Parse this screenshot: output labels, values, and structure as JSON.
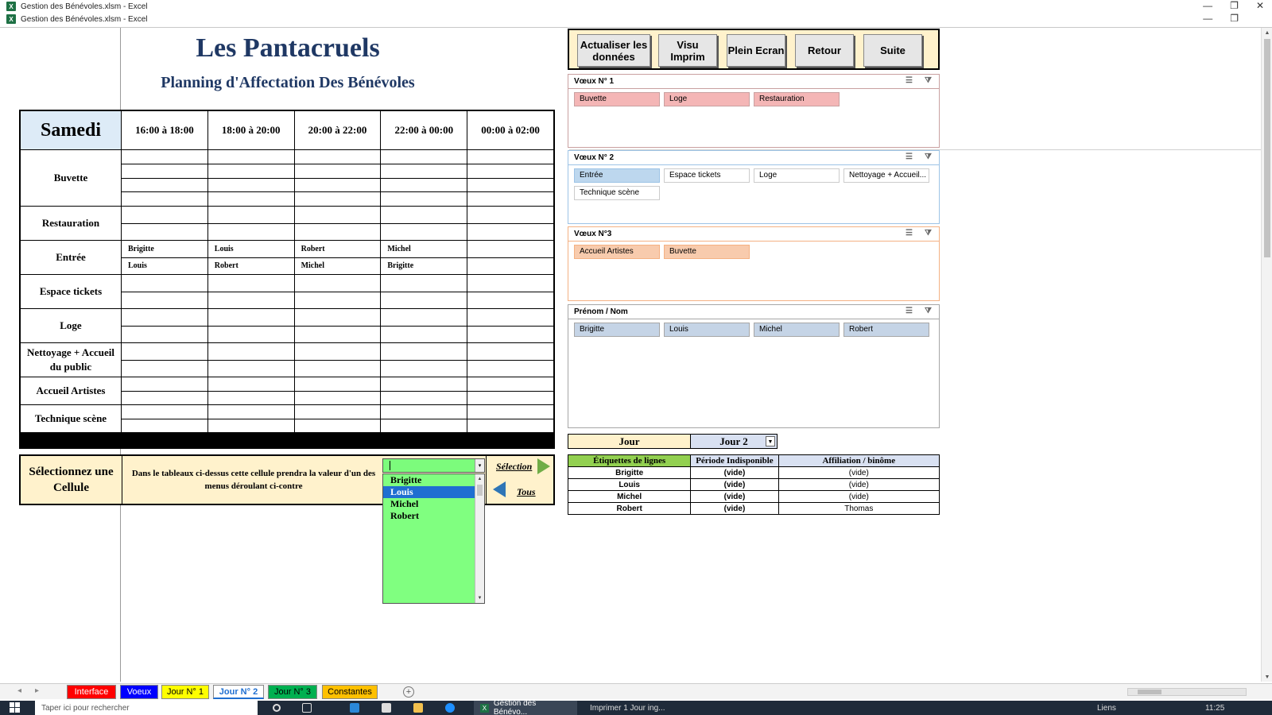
{
  "window": {
    "title1": "Gestion des Bénévoles.xlsm - Excel",
    "title2": "Gestion des Bénévoles.xlsm - Excel",
    "app_badge": "X",
    "controls": [
      "—",
      "❐",
      "✕"
    ]
  },
  "header": {
    "title": "Les Pantacruels",
    "subtitle": "Planning d'Affectation Des Bénévoles"
  },
  "planning": {
    "day": "Samedi",
    "time_slots": [
      "16:00 à 18:00",
      "18:00 à 20:00",
      "20:00 à 22:00",
      "22:00 à 00:00",
      "00:00 à 02:00"
    ],
    "rows": [
      {
        "label": "Buvette",
        "slots": [
          [
            "",
            "",
            "",
            ""
          ],
          [
            "",
            "",
            "",
            ""
          ],
          [
            "",
            "",
            "",
            ""
          ],
          [
            "",
            "",
            "",
            ""
          ],
          [
            "",
            "",
            "",
            ""
          ]
        ]
      },
      {
        "label": "Restauration",
        "slots": [
          [
            "",
            ""
          ],
          [
            "",
            ""
          ],
          [
            "",
            ""
          ],
          [
            "",
            ""
          ],
          [
            "",
            ""
          ]
        ]
      },
      {
        "label": "Entrée",
        "slots": [
          [
            "Brigitte",
            "Louis"
          ],
          [
            "Louis",
            "Robert"
          ],
          [
            "Robert",
            "Michel"
          ],
          [
            "Michel",
            "Brigitte"
          ],
          [
            "",
            ""
          ]
        ]
      },
      {
        "label": "Espace tickets",
        "slots": [
          [
            "",
            ""
          ],
          [
            "",
            ""
          ],
          [
            "",
            ""
          ],
          [
            "",
            ""
          ],
          [
            "",
            ""
          ]
        ]
      },
      {
        "label": "Loge",
        "slots": [
          [
            "",
            ""
          ],
          [
            "",
            ""
          ],
          [
            "",
            ""
          ],
          [
            "",
            ""
          ],
          [
            "",
            ""
          ]
        ]
      },
      {
        "label": "Nettoyage + Accueil du public",
        "slots": [
          [
            "",
            ""
          ],
          [
            "",
            ""
          ],
          [
            "",
            ""
          ],
          [
            "",
            ""
          ],
          [
            "",
            ""
          ]
        ]
      },
      {
        "label": "Accueil Artistes",
        "slots": [
          [
            "",
            ""
          ],
          [
            "",
            ""
          ],
          [
            "",
            ""
          ],
          [
            "",
            ""
          ],
          [
            "",
            ""
          ]
        ]
      },
      {
        "label": "Technique scène",
        "slots": [
          [
            "",
            ""
          ],
          [
            "",
            ""
          ],
          [
            "",
            ""
          ],
          [
            "",
            ""
          ],
          [
            "",
            ""
          ]
        ]
      }
    ]
  },
  "selection": {
    "label": "Sélectionnez une Cellule",
    "hint": "Dans le tableaux ci-dessus cette cellule prendra la valeur d'un des menus déroulant  ci-contre",
    "selection_link": "Sélection",
    "all_link": "Tous"
  },
  "dropdown": {
    "value": "",
    "caret": "▾",
    "options": [
      "Brigitte",
      "Louis",
      "Michel",
      "Robert"
    ],
    "selected_index": 1
  },
  "buttons": {
    "refresh": "Actualiser les données",
    "print_preview": "Visu Imprim",
    "fullscreen": "Plein Ecran",
    "back": "Retour",
    "next": "Suite"
  },
  "slicers": [
    {
      "title": "Vœux N° 1",
      "items": [
        "Buvette",
        "Loge",
        "Restauration"
      ],
      "color": "#f4b6b6",
      "border": "#c9a0a0"
    },
    {
      "title": "Vœux N° 2",
      "items": [
        "Entrée",
        "Espace tickets",
        "Loge",
        "Nettoyage + Accueil...",
        "Technique scène"
      ],
      "selected": [
        "Entrée"
      ],
      "color": "#bdd7ee",
      "border": "#9dc3e6"
    },
    {
      "title": "Vœux N°3",
      "items": [
        "Accueil Artistes",
        "Buvette"
      ],
      "color": "#f8cbad",
      "border": "#f4b183"
    },
    {
      "title": "Prénom / Nom",
      "items": [
        "Brigitte",
        "Louis",
        "Michel",
        "Robert"
      ],
      "color": "#c5d4e6",
      "border": "#a6a6a6"
    }
  ],
  "pivot": {
    "filter_label": "Jour",
    "filter_value": "Jour 2",
    "headers": [
      "Étiquettes de lignes",
      "Période Indisponible",
      "Affiliation / binôme"
    ],
    "rows": [
      [
        "Brigitte",
        "(vide)",
        "(vide)"
      ],
      [
        "Louis",
        "(vide)",
        "(vide)"
      ],
      [
        "Michel",
        "(vide)",
        "(vide)"
      ],
      [
        "Robert",
        "(vide)",
        "Thomas"
      ]
    ]
  },
  "sheet_tabs": [
    {
      "label": "Interface",
      "bg": "#ff0000",
      "fg": "#ffffff"
    },
    {
      "label": "Voeux",
      "bg": "#0000ff",
      "fg": "#ffffff"
    },
    {
      "label": "Jour N° 1",
      "bg": "#ffff00",
      "fg": "#000000"
    },
    {
      "label": "Jour N° 2",
      "bg": "#ffffff",
      "fg": "#1f6fd1",
      "active": true
    },
    {
      "label": "Jour N° 3",
      "bg": "#00b050",
      "fg": "#000000"
    },
    {
      "label": "Constantes",
      "bg": "#ffc000",
      "fg": "#000000"
    }
  ],
  "taskbar": {
    "search_placeholder": "Taper ici pour rechercher",
    "app1": "Gestion des Bénévo...",
    "app2": "Imprimer 1 Jour ing...",
    "time": "11:25",
    "network": "Liens"
  }
}
